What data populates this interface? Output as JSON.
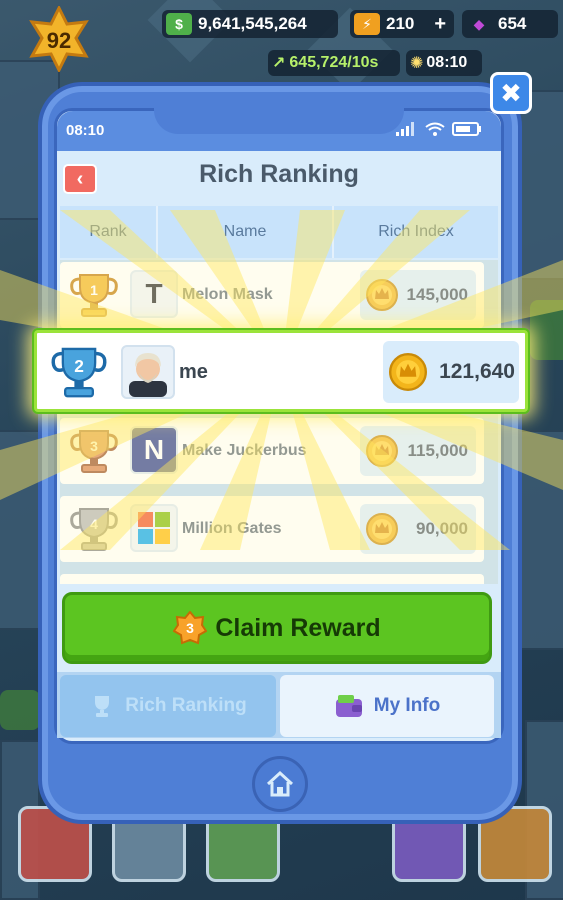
{
  "hud": {
    "level": "92",
    "cash": "9,641,545,264",
    "energy": "210",
    "energy_plus": "+",
    "gems": "654",
    "income_rate": "645,724/10s",
    "timer": "08:10"
  },
  "phone": {
    "status_time": "08:10",
    "title": "Rich Ranking",
    "back_glyph": "‹",
    "close_glyph": "✖"
  },
  "table": {
    "headers": [
      "Rank",
      "Name",
      "Rich Index"
    ]
  },
  "rows": [
    {
      "rank": "1",
      "name": "Melon Mask",
      "rich_index": "145,000",
      "trophy_color": "#f2b21c",
      "avatar_icon": "tesla-logo-icon"
    },
    {
      "rank": "2",
      "name": "me",
      "rich_index": "121,640",
      "trophy_color": "#49a3dd",
      "avatar_icon": "player-avatar-icon"
    },
    {
      "rank": "3",
      "name": "Make Juckerbus",
      "rich_index": "115,000",
      "trophy_color": "#d9804a",
      "avatar_icon": "n-logo-icon"
    },
    {
      "rank": "4",
      "name": "Million Gates",
      "rich_index": "90,000",
      "trophy_color": "#a9a9a9",
      "avatar_icon": "windows-logo-icon"
    }
  ],
  "claim": {
    "badge": "3",
    "label": "Claim Reward"
  },
  "tabs": [
    {
      "label": "Rich Ranking",
      "active": true,
      "icon": "trophy-icon"
    },
    {
      "label": "My Info",
      "active": false,
      "icon": "wallet-icon"
    }
  ],
  "colors": {
    "phone_blue": "#4f7fd6",
    "claim_green": "#5cc521",
    "highlight_green": "#9be33a",
    "coin_gold": "#f3b51b"
  }
}
